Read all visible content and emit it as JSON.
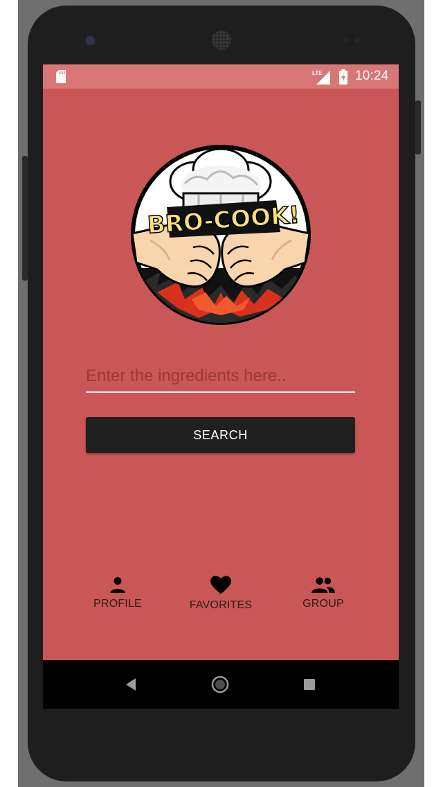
{
  "status_bar": {
    "time": "10:24",
    "network": "LTE",
    "icons": [
      "sd-card-icon",
      "signal-icon",
      "battery-charging-icon"
    ]
  },
  "logo": {
    "text": "BRO-COOK!",
    "icons": [
      "chef-hat-icon",
      "fist-bump-icon"
    ]
  },
  "search": {
    "placeholder": "Enter the ingredients here..",
    "value": "",
    "button_label": "SEARCH"
  },
  "bottom_nav": [
    {
      "label": "PROFILE",
      "icon": "person-icon"
    },
    {
      "label": "FAVORITES",
      "icon": "heart-icon"
    },
    {
      "label": "GROUP",
      "icon": "group-icon"
    }
  ],
  "system_nav": {
    "icons": [
      "back-icon",
      "home-icon",
      "recents-icon"
    ]
  },
  "colors": {
    "background": "#ca5757",
    "status_bar": "#d97676",
    "button": "#202020",
    "button_text": "#ffffff",
    "nav_text": "#2a1a1a"
  }
}
